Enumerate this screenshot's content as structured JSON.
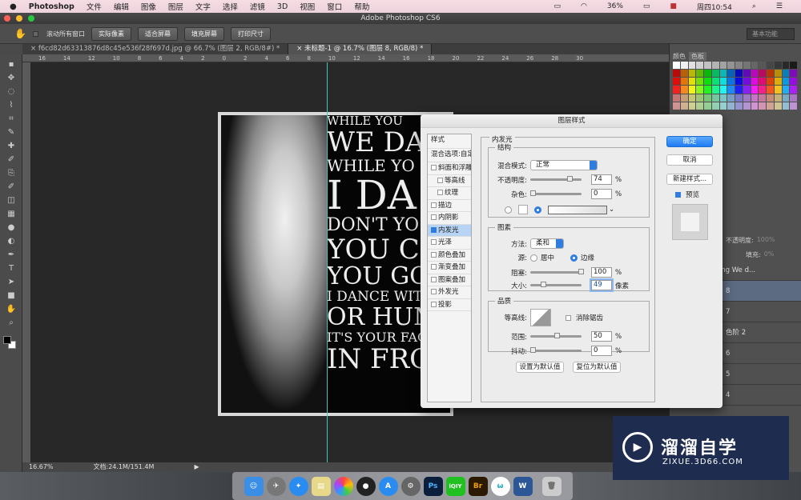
{
  "menubar": {
    "app": "Photoshop",
    "items": [
      "文件",
      "编辑",
      "图像",
      "图层",
      "文字",
      "选择",
      "滤镜",
      "3D",
      "视图",
      "窗口",
      "帮助"
    ],
    "battery": "36%",
    "clock": "周四10:54"
  },
  "window": {
    "title": "Adobe Photoshop CS6"
  },
  "options": {
    "scroll_all": "滚动所有窗口",
    "buttons": [
      "实际像素",
      "适合屏幕",
      "填充屏幕",
      "打印尺寸"
    ],
    "workspace": "基本功能"
  },
  "tabs": [
    {
      "label": "f6cd82d63313876d8c45e536f28f697d.jpg @ 66.7% (图层 2, RGB/8#) *",
      "active": false
    },
    {
      "label": "未标题-1 @ 16.7% (图层 8, RGB/8) *",
      "active": true
    }
  ],
  "ruler": [
    "16",
    "14",
    "12",
    "10",
    "8",
    "6",
    "4",
    "2",
    "0",
    "2",
    "4",
    "6",
    "8",
    "10",
    "12",
    "14",
    "16",
    "18",
    "20",
    "22",
    "24",
    "26",
    "28",
    "30"
  ],
  "canvas_text": [
    "WHILE YOU",
    "WE DA",
    "WHILE YO",
    "I DA",
    "DON'T YO",
    "YOU CO",
    "YOU GO",
    "I DANCE WIT",
    "OR HUM",
    "IT'S YOUR FAC",
    "IN FRO"
  ],
  "status": {
    "zoom": "16.67%",
    "doc": "文档:24.1M/151.4M"
  },
  "right_panel": {
    "tabs": [
      "颜色",
      "色板"
    ],
    "opacity_label": "不透明度:",
    "opacity": "100%",
    "fill_label": "填充:",
    "fill": "0%",
    "layers": [
      {
        "name": "le you're smiling We d...",
        "selected": false
      },
      {
        "name": "8",
        "selected": true
      },
      {
        "name": "7",
        "selected": false
      },
      {
        "name": "色阶 2",
        "selected": false
      },
      {
        "name": "6",
        "selected": false
      },
      {
        "name": "5",
        "selected": false
      },
      {
        "name": "4",
        "selected": false
      }
    ]
  },
  "dialog": {
    "title": "图层样式",
    "styles_header": "样式",
    "blend_options": "混合选项:自定",
    "styles": [
      {
        "label": "斜面和浮雕",
        "checked": false,
        "sub": false
      },
      {
        "label": "等高线",
        "checked": false,
        "sub": true
      },
      {
        "label": "纹理",
        "checked": false,
        "sub": true
      },
      {
        "label": "描边",
        "checked": false,
        "sub": false
      },
      {
        "label": "内阴影",
        "checked": false,
        "sub": false
      },
      {
        "label": "内发光",
        "checked": true,
        "sub": false,
        "selected": true
      },
      {
        "label": "光泽",
        "checked": false,
        "sub": false
      },
      {
        "label": "颜色叠加",
        "checked": false,
        "sub": false
      },
      {
        "label": "渐变叠加",
        "checked": false,
        "sub": false
      },
      {
        "label": "图案叠加",
        "checked": false,
        "sub": false
      },
      {
        "label": "外发光",
        "checked": false,
        "sub": false
      },
      {
        "label": "投影",
        "checked": false,
        "sub": false
      }
    ],
    "section": "内发光",
    "structure": "结构",
    "blend_mode_label": "混合模式:",
    "blend_mode": "正常",
    "opacity_label": "不透明度:",
    "opacity": "74",
    "noise_label": "杂色:",
    "noise": "0",
    "pct": "%",
    "elements": "图素",
    "technique_label": "方法:",
    "technique": "柔和",
    "source_label": "源:",
    "source_center": "居中",
    "source_edge": "边缘",
    "choke_label": "阻塞:",
    "choke": "100",
    "size_label": "大小:",
    "size": "49",
    "px": "像素",
    "quality": "品质",
    "contour_label": "等高线:",
    "antialias": "消除锯齿",
    "range_label": "范围:",
    "range": "50",
    "jitter_label": "抖动:",
    "jitter": "0",
    "make_default": "设置为默认值",
    "reset_default": "复位为默认值",
    "ok": "确定",
    "cancel": "取消",
    "new_style": "新建样式...",
    "preview": "预览"
  },
  "watermark": {
    "brand": "溜溜自学",
    "url": "ZIXUE.3D66.COM"
  },
  "dock": [
    "Ps",
    "iQIY",
    "Br",
    "W"
  ],
  "colors": {
    "accent": "#2f7de1",
    "guide": "#3fc7c7",
    "selected_layer": "#5d6b82"
  }
}
